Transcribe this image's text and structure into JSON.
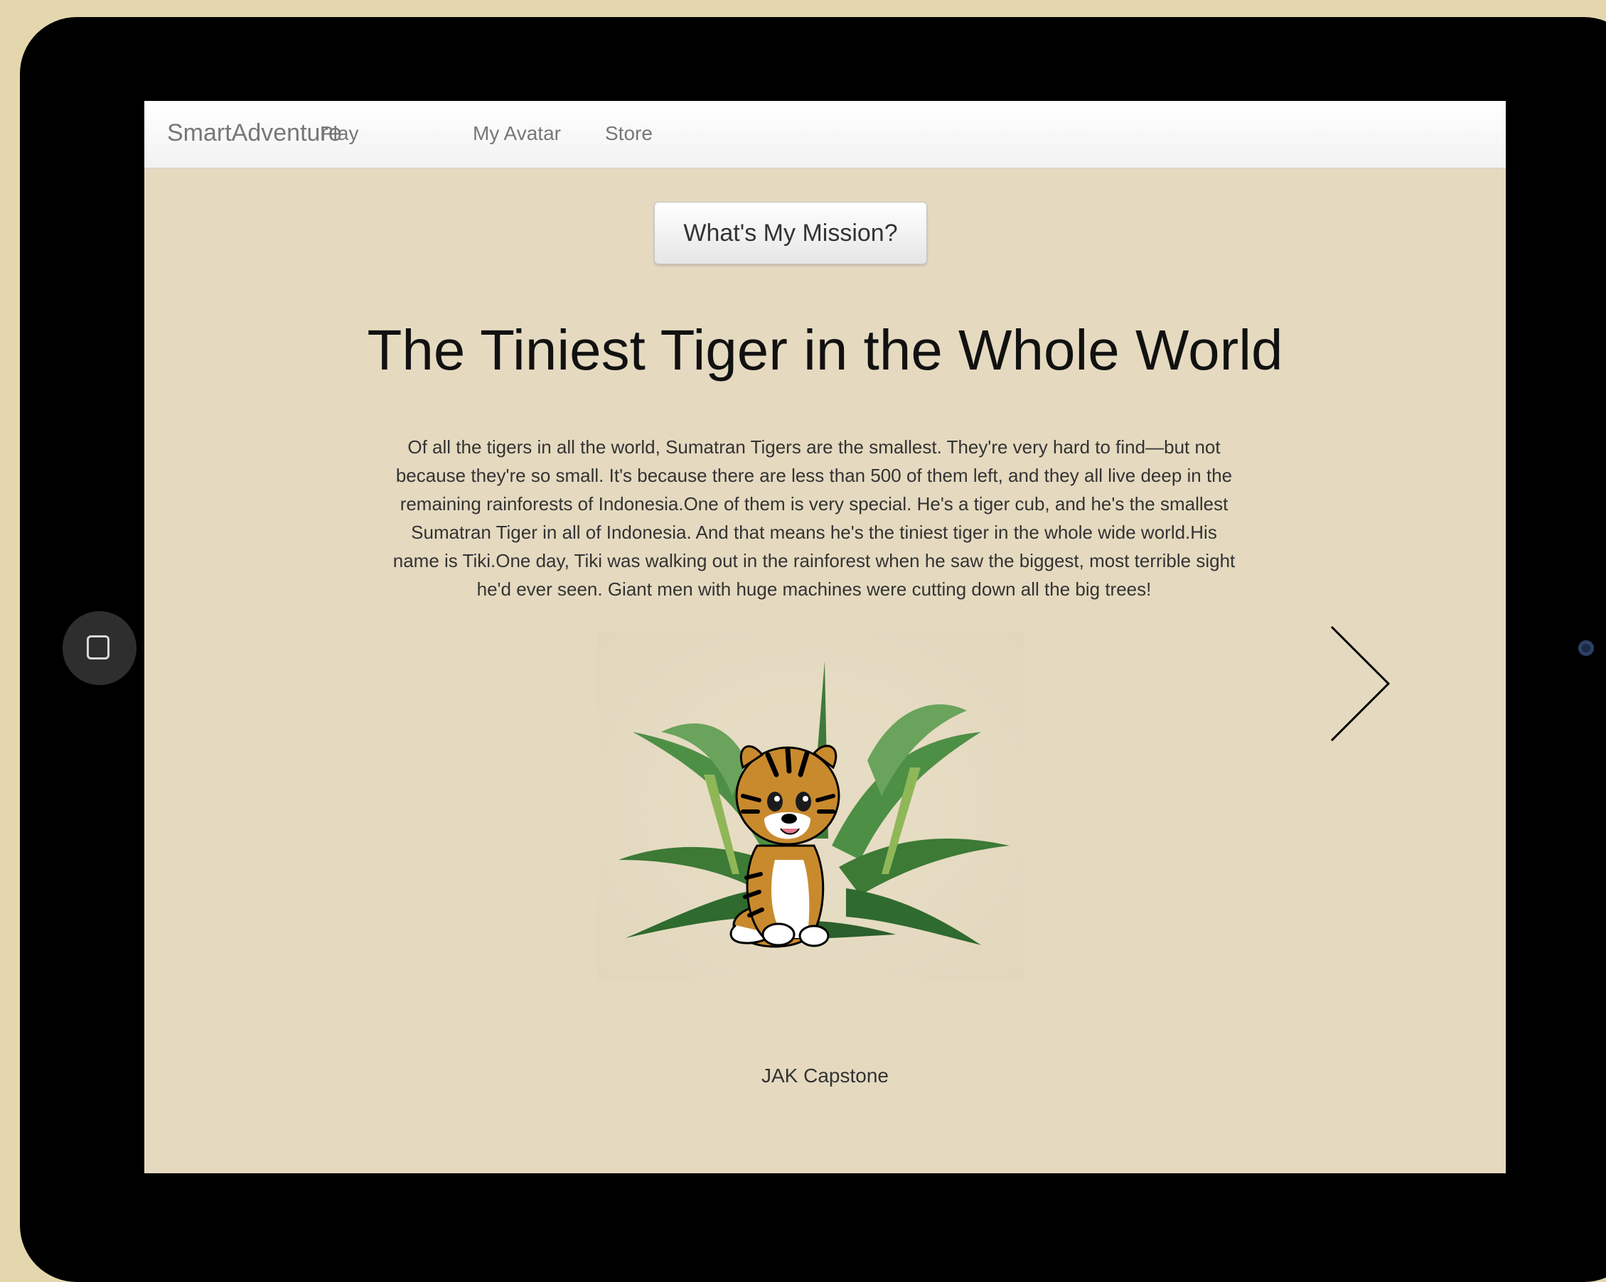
{
  "navbar": {
    "brand": "SmartAdventure",
    "links": [
      "Play",
      "My Avatar",
      "Store"
    ]
  },
  "mission_button": "What's My Mission?",
  "story": {
    "title": "The Tiniest Tiger in the Whole World",
    "text": "Of all the tigers in all the world, Sumatran Tigers are the smallest. They're very hard to find—but not because they're so small. It's because there are less than 500 of them left, and they all live deep in the remaining rainforests of Indonesia.One of them is very special. He's a tiger cub, and he's the smallest Sumatran Tiger in all of Indonesia. And that means he's the tiniest tiger in the whole wide world.His name is Tiki.One day, Tiki was walking out in the rainforest when he saw the biggest, most terrible sight he'd ever seen. Giant men with huge machines were cutting down all the big trees!"
  },
  "footer": "JAK Capstone",
  "icons": {
    "next": "chevron-right-icon",
    "home": "home-button-icon",
    "camera": "camera-icon"
  },
  "colors": {
    "page_background": "#e4d7ae",
    "screen_background": "#e5dac0",
    "tablet_frame": "#000000"
  }
}
